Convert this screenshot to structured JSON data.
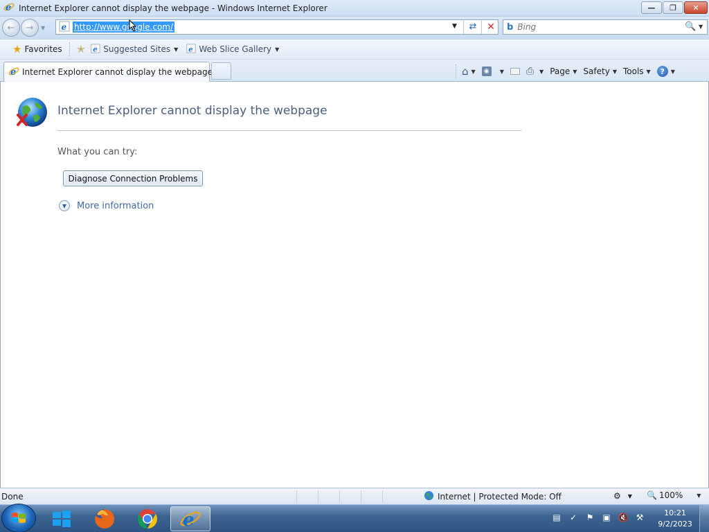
{
  "window": {
    "title": "Internet Explorer cannot display the webpage - Windows Internet Explorer"
  },
  "nav": {
    "address_url": "http://www.google.com/",
    "search_placeholder": "Bing"
  },
  "favorites_bar": {
    "favorites_label": "Favorites",
    "suggested_sites_label": "Suggested Sites",
    "web_slice_gallery_label": "Web Slice Gallery"
  },
  "tabs": [
    {
      "label": "Internet Explorer cannot display the webpage",
      "active": true
    }
  ],
  "command_bar": {
    "page_label": "Page",
    "safety_label": "Safety",
    "tools_label": "Tools"
  },
  "error_page": {
    "title": "Internet Explorer cannot display the webpage",
    "what_you_can_try": "What you can try:",
    "diagnose_button": "Diagnose Connection Problems",
    "more_information": "More information"
  },
  "status_bar": {
    "status_text": "Done",
    "zone_text": "Internet | Protected Mode: Off",
    "zoom": "100%"
  },
  "taskbar": {
    "apps": [
      "windows-explorer",
      "firefox",
      "chrome",
      "internet-explorer"
    ],
    "active_app": "internet-explorer",
    "time": "10:21",
    "date": "9/2/2023"
  },
  "colors": {
    "accent": "#3399ff",
    "error_title": "#4a5f7c",
    "link": "#3e6aa3"
  }
}
